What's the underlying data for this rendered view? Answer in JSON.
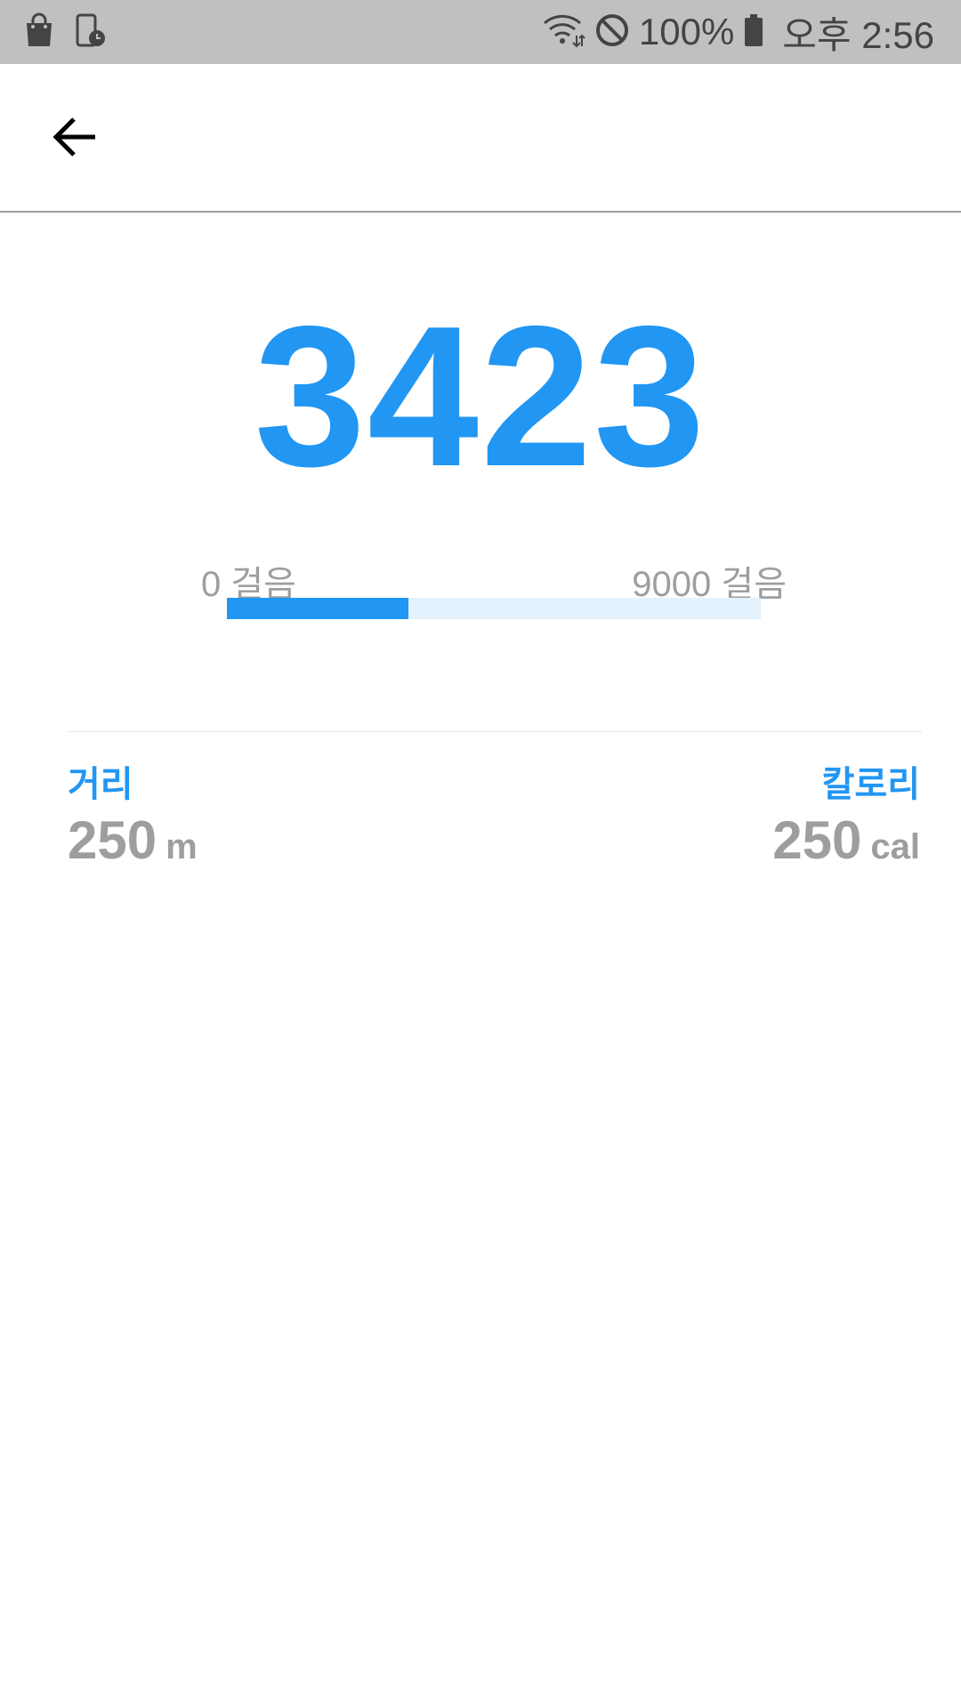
{
  "status_bar": {
    "battery_percent": "100%",
    "time": "오후 2:56",
    "icons": [
      "shopping-bag-icon",
      "phone-clock-icon",
      "wifi-icon",
      "do-not-disturb-icon",
      "battery-icon"
    ]
  },
  "app_bar": {
    "back_icon": "arrow-left-icon"
  },
  "steps": {
    "count": "3423",
    "min_label": "0 걸음",
    "max_label": "9000 걸음",
    "progress_fraction": 0.34
  },
  "stats": {
    "distance": {
      "label": "거리",
      "value": "250",
      "unit": "m"
    },
    "calories": {
      "label": "칼로리",
      "value": "250",
      "unit": "cal"
    }
  },
  "colors": {
    "accent": "#2196f3",
    "accent_light": "#e3f2fd",
    "muted_text": "#9e9e9e",
    "status_bar_bg": "#c0c0c0"
  }
}
